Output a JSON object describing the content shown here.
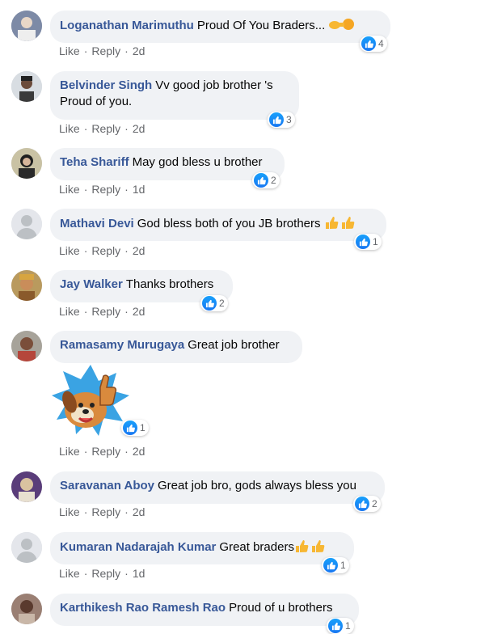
{
  "comments": [
    {
      "author": "Loganathan Marimuthu",
      "text": "Proud Of You Braders...",
      "likes": "4",
      "action_like": "Like",
      "action_reply": "Reply",
      "time": "2d"
    },
    {
      "author": "Belvinder Singh",
      "text": "Vv good job brother 's",
      "text2": "Proud of you.",
      "likes": "3",
      "action_like": "Like",
      "action_reply": "Reply",
      "time": "2d"
    },
    {
      "author": "Teha Shariff",
      "text": "May god bless u brother",
      "likes": "2",
      "action_like": "Like",
      "action_reply": "Reply",
      "time": "1d"
    },
    {
      "author": "Mathavi Devi",
      "text": "God bless both of you JB brothers",
      "likes": "1",
      "action_like": "Like",
      "action_reply": "Reply",
      "time": "2d"
    },
    {
      "author": "Jay Walker",
      "text": "Thanks brothers",
      "likes": "2",
      "action_like": "Like",
      "action_reply": "Reply",
      "time": "2d"
    },
    {
      "author": "Ramasamy Murugaya",
      "text": "Great job brother",
      "likes": "1",
      "action_like": "Like",
      "action_reply": "Reply",
      "time": "2d"
    },
    {
      "author": "Saravanan Aboy",
      "text": "Great job bro, gods always bless you",
      "likes": "2",
      "action_like": "Like",
      "action_reply": "Reply",
      "time": "2d"
    },
    {
      "author": "Kumaran Nadarajah Kumar",
      "text": "Great braders",
      "likes": "1",
      "action_like": "Like",
      "action_reply": "Reply",
      "time": "1d"
    },
    {
      "author": "Karthikesh Rao Ramesh Rao",
      "text": "Proud of u brothers",
      "likes": "1"
    }
  ],
  "colors": {
    "author": "#385898",
    "bubble": "#f0f2f5",
    "meta": "#65676b",
    "like_blue": "#1877f2"
  },
  "icons": {
    "like": "thumbs-up-icon",
    "sticker": "dog-thumbs-up-sticker"
  }
}
